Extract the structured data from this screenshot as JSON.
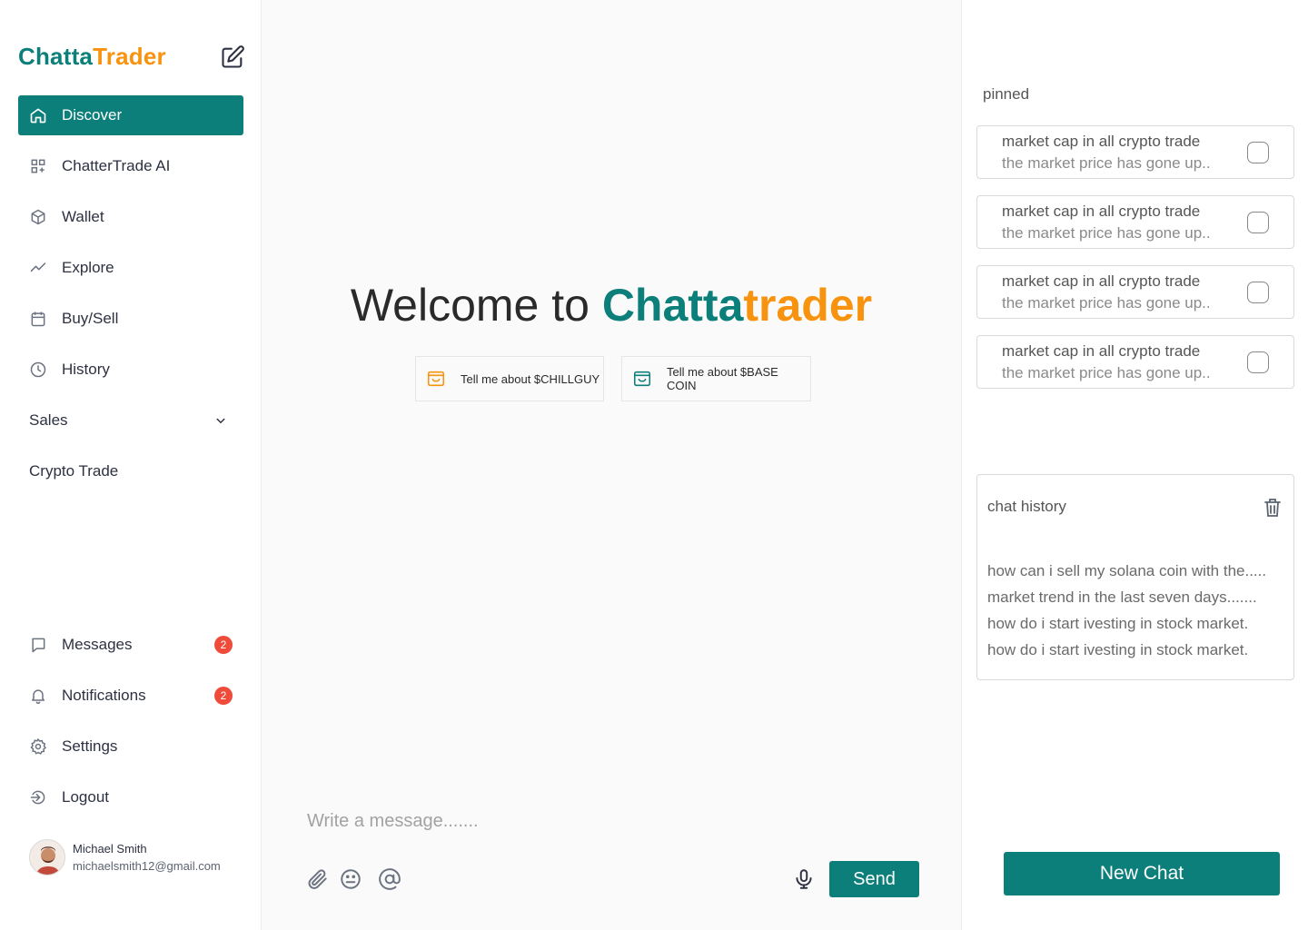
{
  "app": {
    "logo_part1": "Chatta",
    "logo_part2": "Trader",
    "brand_teal": "#0d7f7a",
    "brand_orange": "#f7930f"
  },
  "sidebar": {
    "items": [
      {
        "label": "Discover",
        "icon": "home-icon",
        "active": true
      },
      {
        "label": "ChatterTrade AI",
        "icon": "grid-plus-icon"
      },
      {
        "label": "Wallet",
        "icon": "cube-icon"
      },
      {
        "label": "Explore",
        "icon": "trend-icon"
      },
      {
        "label": "Buy/Sell",
        "icon": "calendar-icon"
      },
      {
        "label": "History",
        "icon": "clock-icon"
      },
      {
        "label": "Sales",
        "icon": "chevron-down-icon"
      },
      {
        "label": "Crypto Trade"
      }
    ],
    "bottom_items": [
      {
        "label": "Messages",
        "icon": "message-icon",
        "badge": "2"
      },
      {
        "label": "Notifications",
        "icon": "bell-icon",
        "badge": "2"
      },
      {
        "label": "Settings",
        "icon": "gear-icon"
      },
      {
        "label": "Logout",
        "icon": "logout-icon"
      }
    ],
    "user": {
      "name": "Michael Smith",
      "email": "michaelsmith12@gmail.com"
    }
  },
  "main": {
    "welcome_prefix": "Welcome to ",
    "welcome_brand1": "Chatta",
    "welcome_brand2": "trader",
    "suggestions": [
      {
        "label": "Tell me about $CHILLGUY",
        "icon": "wallet-icon",
        "color": "#f7930f"
      },
      {
        "label": "Tell me about $BASE COIN",
        "icon": "wallet-icon",
        "color": "#0d7f7a"
      }
    ],
    "composer": {
      "placeholder": "Write a message.......",
      "send_label": "Send"
    }
  },
  "right": {
    "pinned_title": "pinned",
    "pinned": [
      {
        "title": "market cap in all crypto trade",
        "subtitle": "the market price has gone up.."
      },
      {
        "title": "market cap in all crypto trade",
        "subtitle": "the market price has gone up.."
      },
      {
        "title": "market cap in all crypto trade",
        "subtitle": "the market price has gone up.."
      },
      {
        "title": "market cap in all crypto trade",
        "subtitle": "the market price has gone up.."
      }
    ],
    "history_title": "chat history",
    "history": [
      "how can i sell my solana coin with the.....",
      "market trend in the last seven days.......",
      "how do i start ivesting in stock market.",
      "how do i start ivesting in stock market."
    ],
    "new_chat_label": "New Chat"
  }
}
